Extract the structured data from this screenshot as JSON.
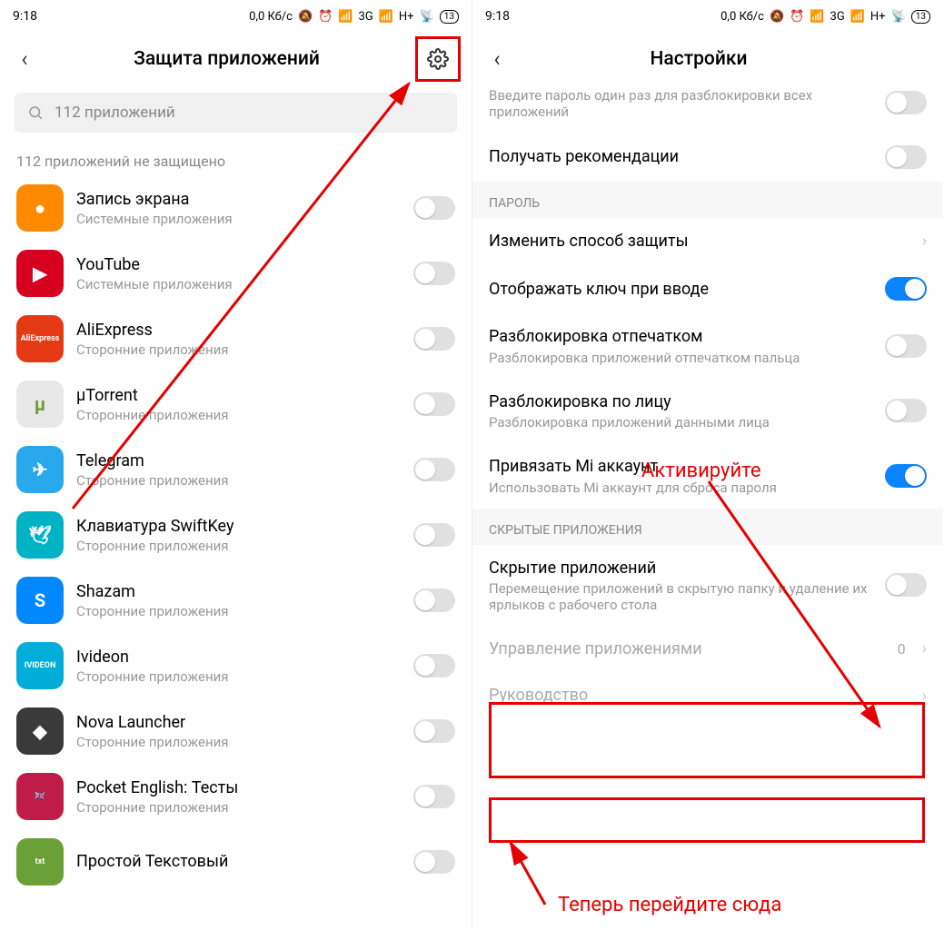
{
  "status": {
    "time": "9:18",
    "data": "0,0 Кб/с",
    "net1": "3G",
    "net2": "H+",
    "battery": "13"
  },
  "left": {
    "title": "Защита приложений",
    "search_placeholder": "112 приложений",
    "section": "112 приложений не защищено",
    "apps": [
      {
        "name": "Запись экрана",
        "sub": "Системные приложения",
        "color": "#ff8a00",
        "glyph": "●"
      },
      {
        "name": "YouTube",
        "sub": "Системные приложения",
        "color": "#d7001f",
        "glyph": "▶"
      },
      {
        "name": "AliExpress",
        "sub": "Сторонние приложения",
        "color": "#e43a15",
        "glyph": "AliExpress"
      },
      {
        "name": "μTorrent",
        "sub": "Сторонние приложения",
        "color": "#e8e8e8",
        "glyph": "µ"
      },
      {
        "name": "Telegram",
        "sub": "Сторонние приложения",
        "color": "#29a9eb",
        "glyph": "✈"
      },
      {
        "name": "Клавиатура SwiftKey",
        "sub": "Сторонние приложения",
        "color": "#00b3c4",
        "glyph": "🕊"
      },
      {
        "name": "Shazam",
        "sub": "Сторонние приложения",
        "color": "#0088ff",
        "glyph": "S"
      },
      {
        "name": "Ivideon",
        "sub": "Сторонние приложения",
        "color": "#00acd8",
        "glyph": "IVIDEON"
      },
      {
        "name": "Nova Launcher",
        "sub": "Сторонние приложения",
        "color": "#3a3a3a",
        "glyph": "◆"
      },
      {
        "name": "Pocket English: Тесты",
        "sub": "Сторонние приложения",
        "color": "#c01c4a",
        "glyph": "🇬🇧"
      },
      {
        "name": "Простой Текстовый",
        "sub": "",
        "color": "#6aa038",
        "glyph": "txt"
      }
    ]
  },
  "right": {
    "title": "Настройки",
    "cutoff_sub": "Введите пароль один раз для разблокировки всех приложений",
    "recs": "Получать рекомендации",
    "section_pass": "ПАРОЛЬ",
    "change_method": "Изменить способ защиты",
    "show_key": "Отображать ключ при вводе",
    "fp": "Разблокировка отпечатком",
    "fp_sub": "Разблокировка приложений отпечатком пальца",
    "face": "Разблокировка по лицу",
    "face_sub": "Разблокировка приложений данными лица",
    "mi": "Привязать Mi аккаунт",
    "mi_sub": "Использовать Mi аккаунт для сброса пароля",
    "section_hidden": "СКРЫТЫЕ ПРИЛОЖЕНИЯ",
    "hide": "Скрытие приложений",
    "hide_sub": "Перемещение приложений в скрытую папку и удаление их ярлыков с рабочего стола",
    "manage": "Управление приложениями",
    "manage_count": "0",
    "guide": "Руководство"
  },
  "annotations": {
    "activate": "Активируйте",
    "goto": "Теперь перейдите сюда"
  }
}
